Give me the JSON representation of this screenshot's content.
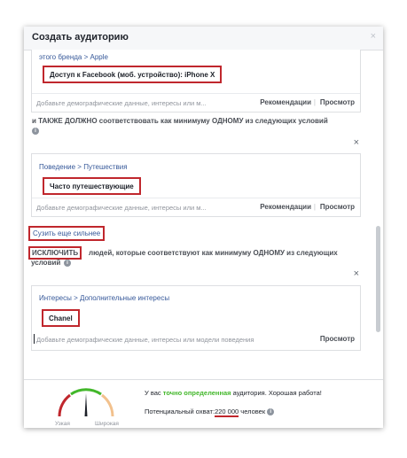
{
  "dialog": {
    "title": "Создать аудиторию",
    "close_icon": "×"
  },
  "include_block": {
    "crumb": "этого бренда > Apple",
    "chip": "Доступ к Facebook (моб. устройство): iPhone X",
    "placeholder": "Добавьте демографические данные, интересы или м...",
    "recommendations": "Рекомендации",
    "separator": "|",
    "preview": "Просмотр"
  },
  "and_condition": {
    "text": "и ТАКЖЕ ДОЛЖНО соответствовать как минимуму ОДНОМУ из следующих условий",
    "info_icon": "i",
    "remove_icon": "×"
  },
  "behavior_block": {
    "crumb": "Поведение > Путешествия",
    "chip": "Часто путешествующие",
    "placeholder": "Добавьте демографические данные, интересы или м...",
    "recommendations": "Рекомендации",
    "separator": "|",
    "preview": "Просмотр"
  },
  "narrow_link": "Сузить еще сильнее",
  "exclude": {
    "keyword": "ИСКЛЮЧИТЬ",
    "rest": "людей, которые соответствуют как минимуму ОДНОМУ из следующих",
    "rest_line2": "условий",
    "info_icon": "i",
    "remove_icon": "×"
  },
  "exclude_block": {
    "crumb": "Интересы > Дополнительные интересы",
    "chip": "Chanel",
    "placeholder": "Добавьте демографические данные, интересы или модели поведения",
    "preview": "Просмотр"
  },
  "footer": {
    "status_prefix": "У вас ",
    "status_bold": "точно определенная",
    "status_suffix": " аудитория. Хорошая работа!",
    "reach_label": "Потенциальный охват:",
    "reach_value": "220 000",
    "reach_unit": " человек",
    "info_icon": "i",
    "gauge_narrow": "Узкая",
    "gauge_wide": "Широкая",
    "gauge_level": 0.5
  },
  "colors": {
    "highlight": "#c0272d",
    "link": "#365899",
    "good": "#42b72a"
  }
}
